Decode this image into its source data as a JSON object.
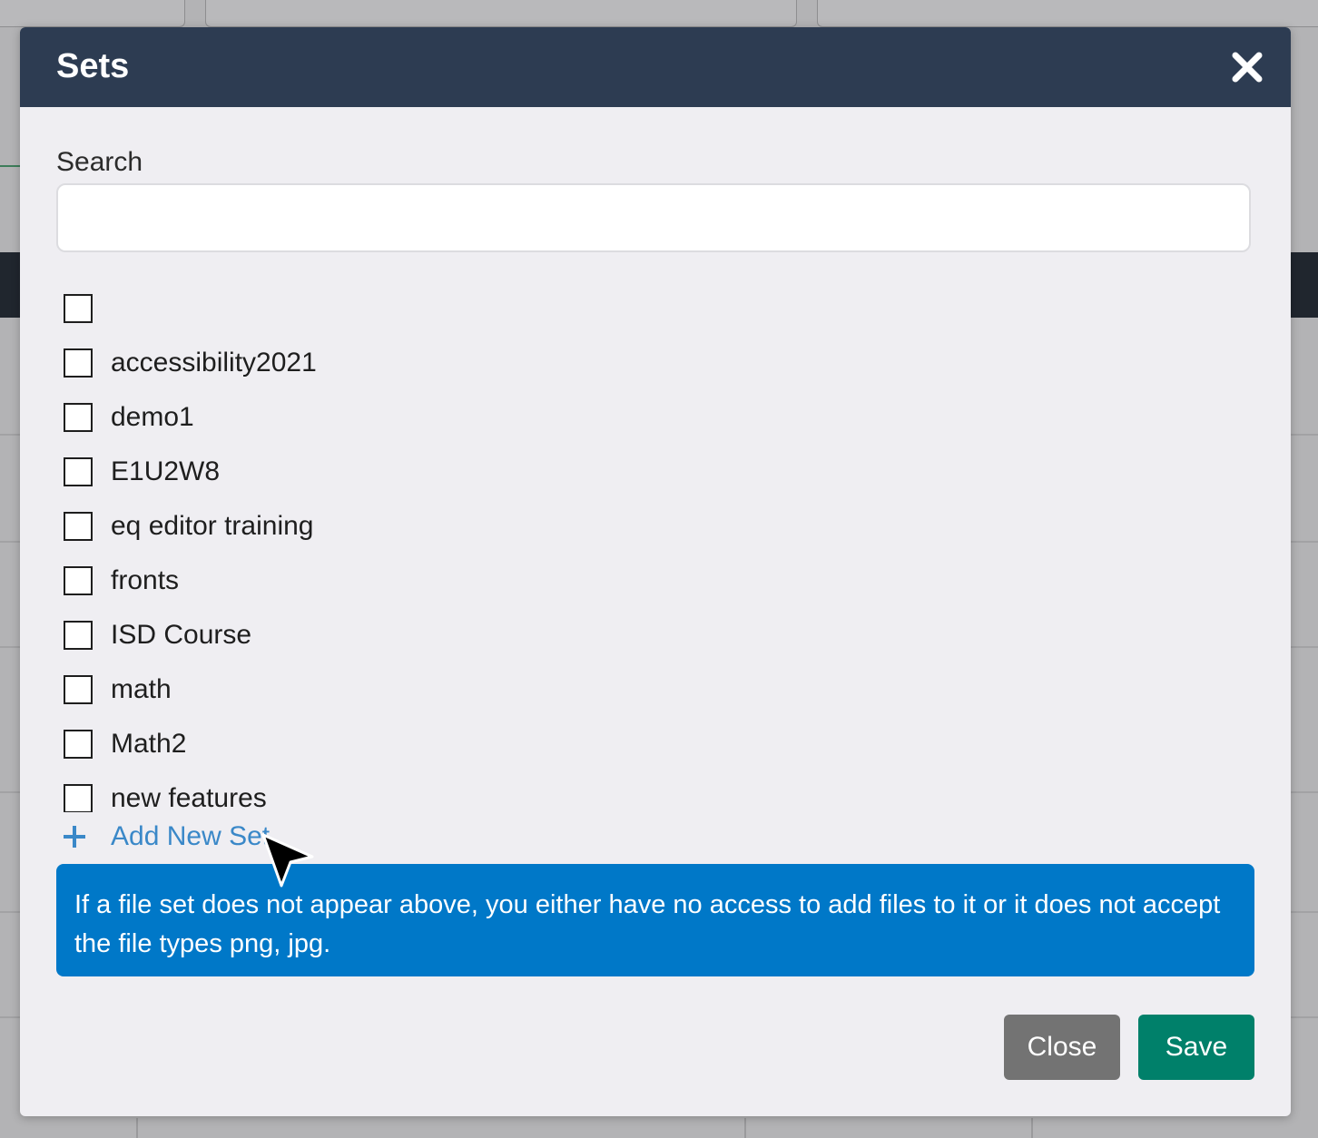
{
  "modal": {
    "title": "Sets",
    "search": {
      "label": "Search",
      "value": "",
      "placeholder": ""
    },
    "sets": [
      {
        "label": "",
        "checked": false
      },
      {
        "label": "accessibility2021",
        "checked": false
      },
      {
        "label": "demo1",
        "checked": false
      },
      {
        "label": "E1U2W8",
        "checked": false
      },
      {
        "label": "eq editor training",
        "checked": false
      },
      {
        "label": "fronts",
        "checked": false
      },
      {
        "label": "ISD Course",
        "checked": false
      },
      {
        "label": "math",
        "checked": false
      },
      {
        "label": "Math2",
        "checked": false
      },
      {
        "label": "new features",
        "checked": false
      }
    ],
    "add_new_label": "Add New Set",
    "info_text": "If a file set does not appear above, you either have no access to add files to it or it does not accept the file types png, jpg.",
    "buttons": {
      "close": "Close",
      "save": "Save"
    }
  },
  "colors": {
    "header_bg": "#2d3c52",
    "info_bg": "#0078c8",
    "link": "#3a88c8",
    "save_bg": "#00806a",
    "close_bg": "#737373"
  },
  "icons": {
    "close": "close-icon",
    "add": "plus-icon",
    "pointer": "mouse-pointer-icon"
  }
}
